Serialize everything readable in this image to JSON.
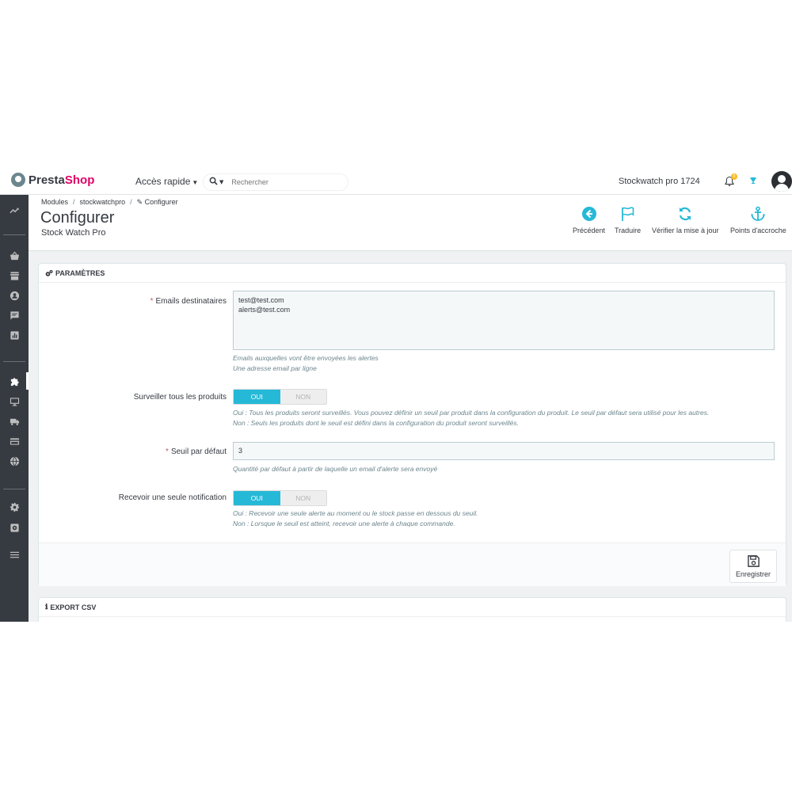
{
  "header": {
    "logo_prefix": "Presta",
    "logo_suffix": "Shop",
    "quick_access": "Accès rapide",
    "search_placeholder": "Rechercher",
    "shop_name": "Stockwatch pro 1724",
    "notification_count": "0"
  },
  "breadcrumb": {
    "items": [
      "Modules",
      "stockwatchpro",
      "Configurer"
    ]
  },
  "page": {
    "title": "Configurer",
    "subtitle": "Stock Watch Pro"
  },
  "toolbar": {
    "back_label": "Précédent",
    "translate_label": "Traduire",
    "update_label": "Vérifier la mise à jour",
    "hooks_label": "Points d'accroche"
  },
  "settings": {
    "heading": "PARAMÈTRES",
    "emails_label": "Emails destinataires",
    "emails_value": "test@test.com\nalerts@test.com",
    "emails_help_1": "Emails auxquelles vont être envoyées les alertes",
    "emails_help_2": "Une adresse email par ligne",
    "watch_all_label": "Surveiller tous les produits",
    "yes": "OUI",
    "no": "NON",
    "watch_all_help_1": "Oui : Tous les produits seront surveillés. Vous pouvez définir un seuil par produit dans la configuration du produit. Le seuil par défaut sera utilisé pour les autres.",
    "watch_all_help_2": "Non : Seuls les produits dont le seuil est défini dans la configuration du produit seront surveillés.",
    "threshold_label": "Seuil par défaut",
    "threshold_value": "3",
    "threshold_help": "Quantité par défaut à partir de laquelle un email d'alerte sera envoyé",
    "single_notif_label": "Recevoir une seule notification",
    "single_notif_help_1": "Oui : Recevoir une seule alerte au moment ou le stock passe en dessous du seuil.",
    "single_notif_help_2": "Non : Lorsque le seuil est atteint, recevoir une alerte à chaque commande.",
    "save_label": "Enregistrer"
  },
  "export": {
    "heading": "EXPORT CSV"
  },
  "colors": {
    "accent": "#25b9d7",
    "sidebar": "#363a41",
    "brand_pink": "#df0067"
  }
}
